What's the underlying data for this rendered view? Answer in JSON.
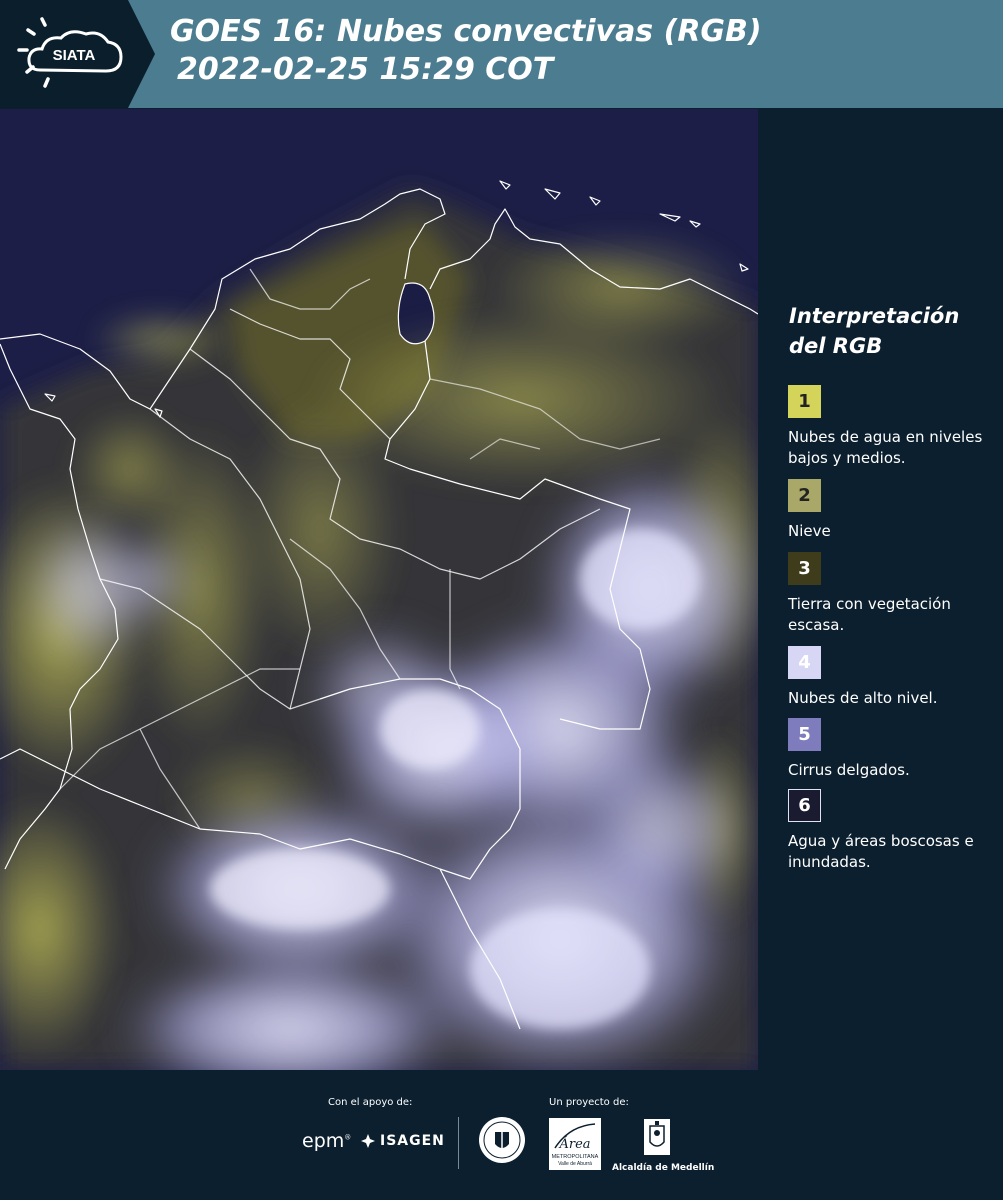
{
  "header": {
    "logo_text": "SIATA",
    "title_line1": "GOES 16: Nubes convectivas (RGB)",
    "title_line2": "2022-02-25 15:29 COT"
  },
  "map": {
    "image_icon": "satellite-rgb-image",
    "colors": {
      "background": "#1b1d45",
      "low_clouds": "#c9c64a",
      "high_clouds": "#cfcdf4",
      "borders": "#ffffff"
    }
  },
  "legend": {
    "title": "Interpretación del RGB",
    "items": [
      {
        "number": "1",
        "label": "Nubes de agua en niveles bajos y medios.",
        "color": "#d4d35a"
      },
      {
        "number": "2",
        "label": "Nieve",
        "color": "#a9a869"
      },
      {
        "number": "3",
        "label": "Tierra con vegetación escasa.",
        "color": "#3e3c1a"
      },
      {
        "number": "4",
        "label": "Nubes de alto nivel.",
        "color": "#d8d6f5"
      },
      {
        "number": "5",
        "label": "Cirrus delgados.",
        "color": "#7f7cbd"
      },
      {
        "number": "6",
        "label": "Agua y áreas boscosas e inundadas.",
        "color": "#1a1a30"
      }
    ]
  },
  "footer": {
    "support_label": "Con el apoyo de:",
    "project_label": "Un proyecto de:",
    "sponsor1": "epm",
    "sponsor2": "ISAGEN",
    "area_line1": "Área",
    "area_line2": "METROPOLITANA",
    "area_line3": "Valle de Aburrá",
    "alcaldia": "Alcaldía de Medellín"
  }
}
